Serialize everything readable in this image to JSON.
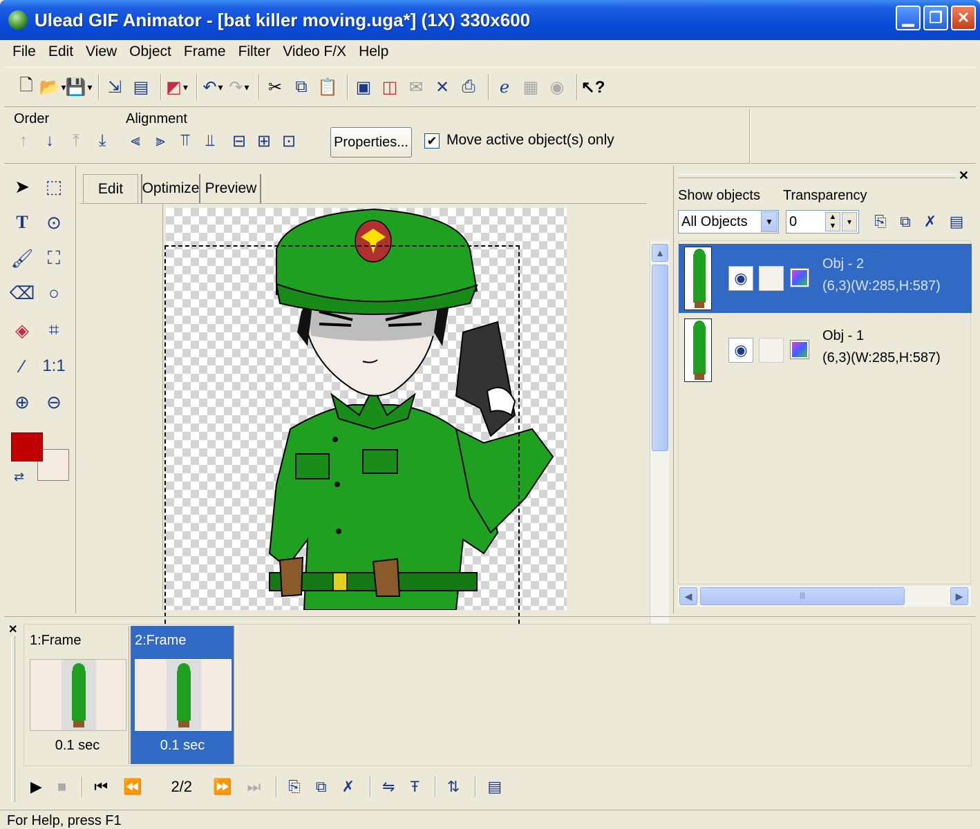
{
  "window": {
    "title": "Ulead GIF Animator - [bat killer moving.uga*] (1X) 330x600",
    "icon": "app-icon",
    "buttons": [
      "minimize",
      "restore",
      "close"
    ]
  },
  "menu": [
    "File",
    "Edit",
    "View",
    "Object",
    "Frame",
    "Filter",
    "Video F/X",
    "Help"
  ],
  "toolbar": {
    "icons": [
      "new-icon",
      "open-icon",
      "save-icon",
      "add-image-icon",
      "add-video-icon",
      "export-icon",
      "undo-icon",
      "redo-icon",
      "cut-icon",
      "copy-icon",
      "paste-icon",
      "select-all-icon",
      "duplicate-icon",
      "animation-wizard-icon",
      "delete-icon",
      "browser-preview-icon",
      "ie-icon",
      "optimize-icon",
      "banner-icon",
      "help-icon"
    ]
  },
  "propbar": {
    "order_label": "Order",
    "alignment_label": "Alignment",
    "properties_button": "Properties...",
    "move_active_label": "Move active object(s) only",
    "move_active_checked": true
  },
  "tabs": [
    "Edit",
    "Optimize",
    "Preview"
  ],
  "active_tab": "Edit",
  "colors": {
    "foreground": "#c00000",
    "background": "#f4ece2",
    "selection": "#316ac5"
  },
  "objects_panel": {
    "show_objects_label": "Show objects",
    "transparency_label": "Transparency",
    "show_objects_value": "All Objects",
    "transparency_value": "0",
    "objects": [
      {
        "name": "Obj - 2",
        "info": "(6,3)(W:285,H:587)",
        "selected": true
      },
      {
        "name": "Obj - 1",
        "info": "(6,3)(W:285,H:587)",
        "selected": false
      }
    ]
  },
  "frames": [
    {
      "label": "1:Frame",
      "delay": "0.1 sec",
      "selected": false
    },
    {
      "label": "2:Frame",
      "delay": "0.1 sec",
      "selected": true
    }
  ],
  "player": {
    "counter": "2/2"
  },
  "status": {
    "text": "For Help, press F1"
  }
}
